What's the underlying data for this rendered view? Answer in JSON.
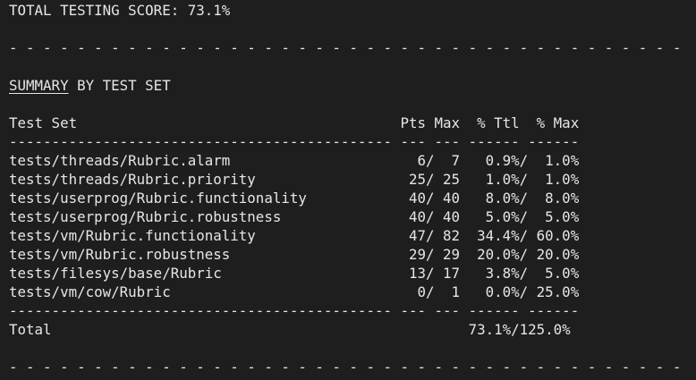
{
  "total_score_line": "TOTAL TESTING SCORE: 73.1%",
  "separator_dashed": "- - - - - - - - - - - - - - - - - - - - - - - - - - - - - - - - - - - - - - - -",
  "summary": {
    "title_underlined": "SUMMARY",
    "title_rest": " BY TEST SET"
  },
  "table": {
    "header": "Test Set                                      Pts Max  % Ttl  % Max",
    "rule": "--------------------------------------------- --- --- ------ ------",
    "rows": [
      {
        "line": "tests/threads/Rubric.alarm                      6/  7   0.9%/  1.0%"
      },
      {
        "line": "tests/threads/Rubric.priority                  25/ 25   1.0%/  1.0%"
      },
      {
        "line": "tests/userprog/Rubric.functionality            40/ 40   8.0%/  8.0%"
      },
      {
        "line": "tests/userprog/Rubric.robustness               40/ 40   5.0%/  5.0%"
      },
      {
        "line": "tests/vm/Rubric.functionality                  47/ 82  34.4%/ 60.0%"
      },
      {
        "line": "tests/vm/Rubric.robustness                     29/ 29  20.0%/ 20.0%"
      },
      {
        "line": "tests/filesys/base/Rubric                      13/ 17   3.8%/  5.0%"
      },
      {
        "line": "tests/vm/cow/Rubric                             0/  1   0.0%/ 25.0%"
      }
    ],
    "total": "Total                                                 73.1%/125.0%"
  }
}
